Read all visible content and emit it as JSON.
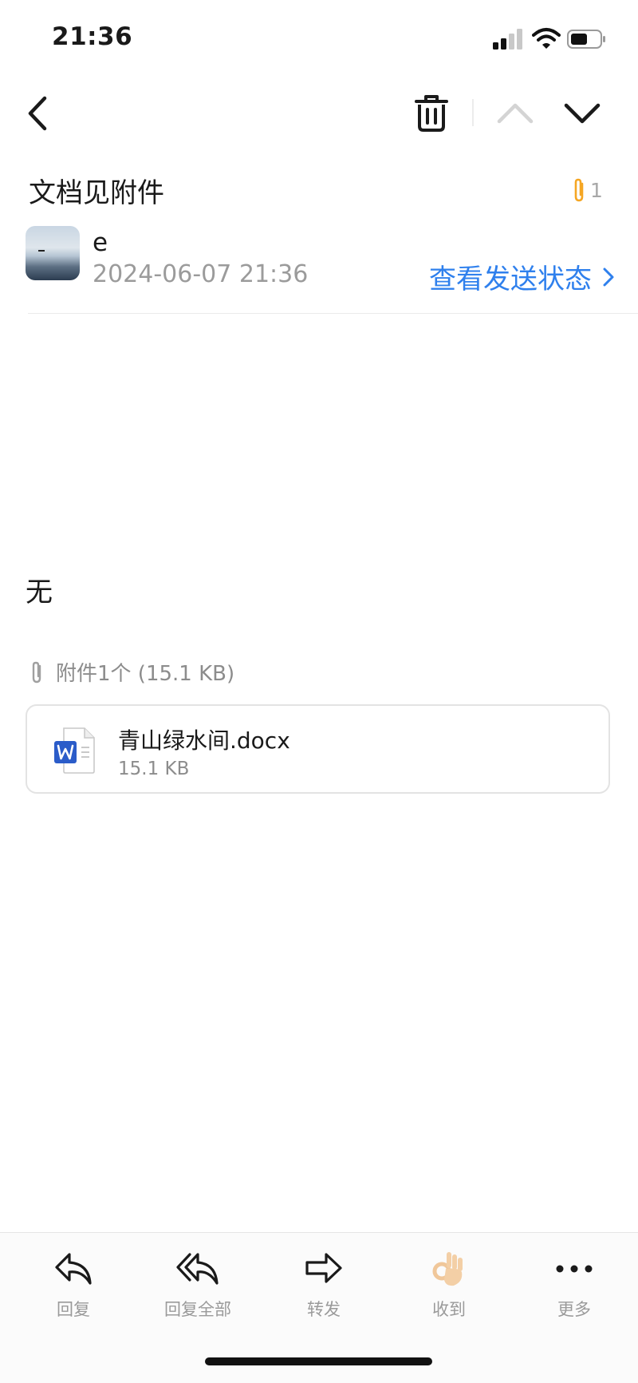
{
  "status_bar": {
    "time": "21:36",
    "icons": [
      "signal-icon",
      "wifi-icon",
      "battery-icon"
    ]
  },
  "nav": {
    "icons": [
      "back-icon",
      "trash-icon",
      "chevron-up-icon",
      "chevron-down-icon"
    ]
  },
  "email": {
    "subject": "文档见附件",
    "attachment_count": "1",
    "sender": "e",
    "datetime": "2024-06-07 21:36",
    "send_status_link": "查看发送状态",
    "body": "无"
  },
  "attachments": {
    "summary": "附件1个 (15.1 KB)",
    "items": [
      {
        "name": "青山绿水间.docx",
        "size": "15.1 KB",
        "icon": "word-doc-icon"
      }
    ]
  },
  "toolbar": {
    "items": [
      {
        "label": "回复",
        "icon": "reply-icon"
      },
      {
        "label": "回复全部",
        "icon": "reply-all-icon"
      },
      {
        "label": "转发",
        "icon": "forward-icon"
      },
      {
        "label": "收到",
        "icon": "ok-hand-icon"
      },
      {
        "label": "更多",
        "icon": "more-icon"
      }
    ]
  },
  "colors": {
    "link": "#2f80ed",
    "attachment_clip": "#f5a623",
    "muted_text": "#9b9b9b",
    "word_blue": "#2b5cc9"
  }
}
